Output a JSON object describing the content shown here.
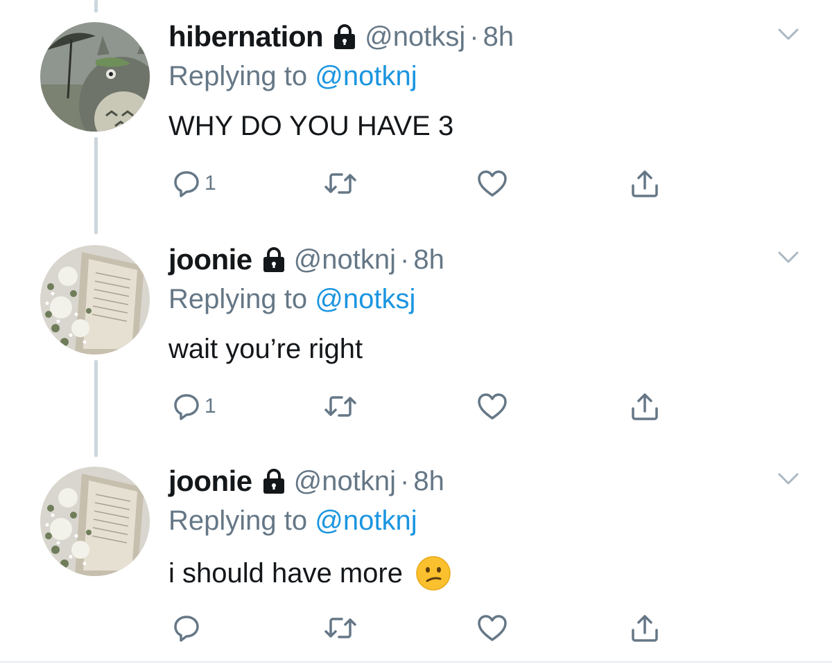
{
  "colors": {
    "text": "#14171a",
    "secondary": "#657786",
    "link": "#1b95e0",
    "thread_line": "#ccd6dd"
  },
  "tweets": [
    {
      "display_name": "hibernation",
      "handle": "@notksj",
      "separator": "·",
      "time": "8h",
      "replying_prefix": "Replying to",
      "replying_to": "@notknj",
      "text": "WHY DO YOU HAVE 3",
      "reply_count": "1",
      "avatar": "totoro-avatar",
      "emoji": null
    },
    {
      "display_name": "joonie",
      "handle": "@notknj",
      "separator": "·",
      "time": "8h",
      "replying_prefix": "Replying to",
      "replying_to": "@notksj",
      "text": "wait you’re right",
      "reply_count": "1",
      "avatar": "book-flowers-avatar",
      "emoji": null
    },
    {
      "display_name": "joonie",
      "handle": "@notknj",
      "separator": "·",
      "time": "8h",
      "replying_prefix": "Replying to",
      "replying_to": "@notknj",
      "text": "i should have more",
      "reply_count": "",
      "avatar": "book-flowers-avatar",
      "emoji": "confused-face-icon"
    }
  ]
}
